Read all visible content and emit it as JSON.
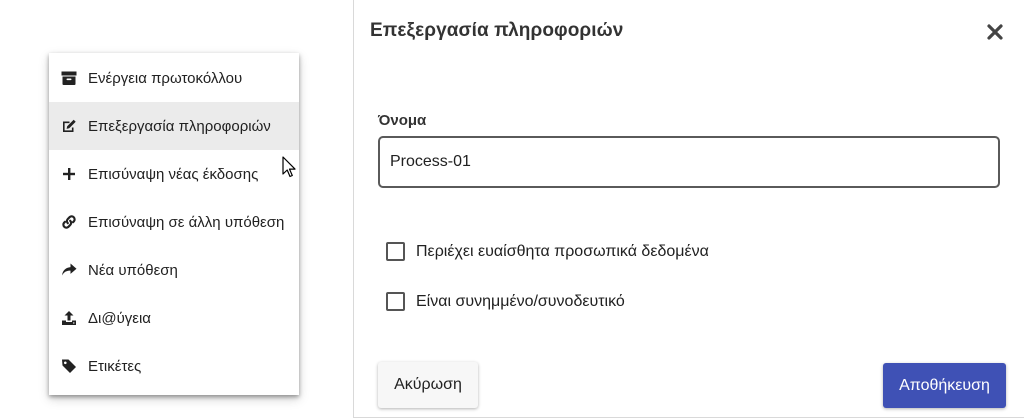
{
  "context_menu": {
    "items": [
      {
        "label": "Ενέργεια πρωτοκόλλου",
        "icon": "archive-icon"
      },
      {
        "label": "Επεξεργασία πληροφοριών",
        "icon": "edit-icon",
        "hovered": true
      },
      {
        "label": "Επισύναψη νέας έκδοσης",
        "icon": "plus-icon"
      },
      {
        "label": "Επισύναψη σε άλλη υπόθεση",
        "icon": "link-icon"
      },
      {
        "label": "Νέα υπόθεση",
        "icon": "share-arrow-icon"
      },
      {
        "label": "Δι@ύγεια",
        "icon": "upload-icon"
      },
      {
        "label": "Ετικέτες",
        "icon": "tag-icon"
      }
    ]
  },
  "dialog": {
    "title": "Επεξεργασία πληροφοριών",
    "close_icon": "close-icon",
    "name_label": "Όνομα",
    "name_value": "Process-01",
    "checkboxes": [
      {
        "label": "Περιέχει ευαίσθητα προσωπικά δεδομένα",
        "checked": false
      },
      {
        "label": "Είναι συνημμένο/συνοδευτικό",
        "checked": false
      }
    ],
    "cancel_label": "Ακύρωση",
    "save_label": "Αποθήκευση"
  },
  "colors": {
    "primary": "#3f51b5",
    "hover": "#ebebeb",
    "text": "#212121"
  }
}
